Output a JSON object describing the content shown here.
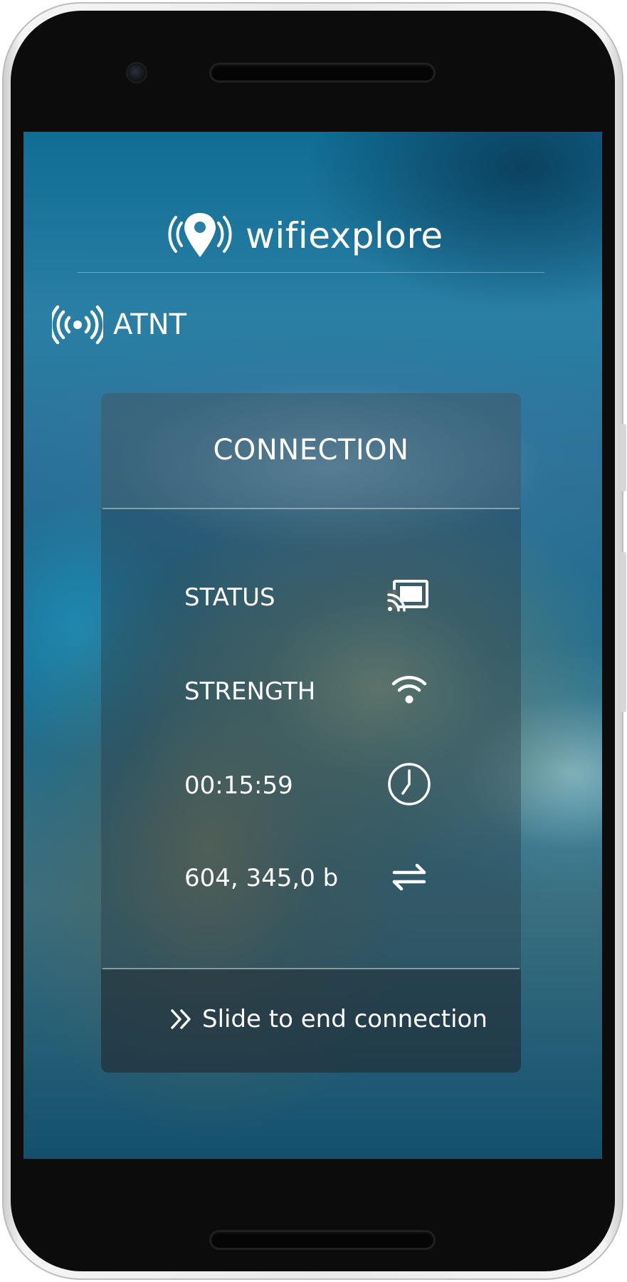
{
  "app": {
    "title": "wifiexplore",
    "logo_icon": "wifi-location-pin-icon"
  },
  "network": {
    "name": "ATNT",
    "icon": "broadcast-signal-icon"
  },
  "connection_card": {
    "title": "CONNECTION",
    "stats": [
      {
        "label": "STATUS",
        "icon": "cast-icon"
      },
      {
        "label": "STRENGTH",
        "icon": "wifi-signal-icon"
      },
      {
        "label": "00:15:59",
        "icon": "clock-icon"
      },
      {
        "label": "604, 345,0 b",
        "icon": "data-transfer-icon"
      }
    ],
    "action": {
      "label": "Slide to end connection",
      "icon": "double-chevron-right-icon"
    }
  },
  "colors": {
    "text": "#ffffff",
    "bezel": "#0c0c0c",
    "screen_base": "#1e6e90"
  }
}
